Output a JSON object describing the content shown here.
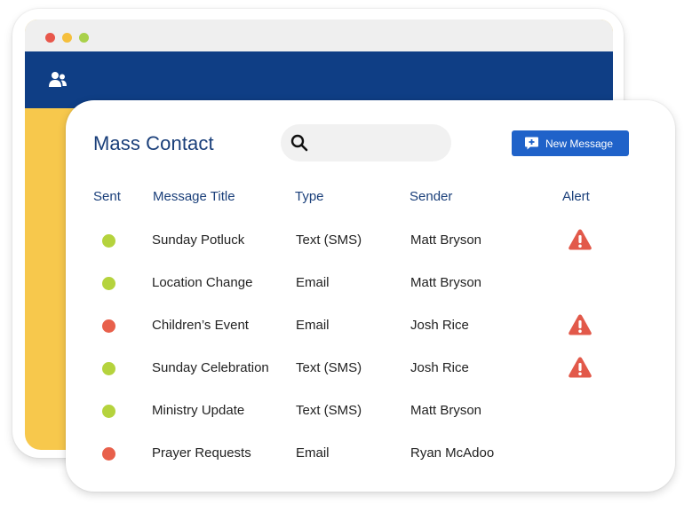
{
  "app": {
    "title": "Mass Contact"
  },
  "search": {
    "placeholder": ""
  },
  "toolbar": {
    "new_message_label": "New Message"
  },
  "colors": {
    "brand_navy": "#0f3e85",
    "accent_blue": "#1f62c9",
    "sent_ok": "#b5d33d",
    "sent_fail": "#e8604b",
    "alert": "#e2594a"
  },
  "table": {
    "headers": {
      "sent": "Sent",
      "title": "Message Title",
      "type": "Type",
      "sender": "Sender",
      "alert": "Alert"
    },
    "rows": [
      {
        "status": "sent",
        "title": "Sunday Potluck",
        "type": "Text (SMS)",
        "sender": "Matt Bryson",
        "alert": true
      },
      {
        "status": "sent",
        "title": "Location Change",
        "type": "Email",
        "sender": "Matt Bryson",
        "alert": false
      },
      {
        "status": "failed",
        "title": "Children’s Event",
        "type": "Email",
        "sender": "Josh Rice",
        "alert": true
      },
      {
        "status": "sent",
        "title": "Sunday Celebration",
        "type": "Text (SMS)",
        "sender": "Josh Rice",
        "alert": true
      },
      {
        "status": "sent",
        "title": "Ministry Update",
        "type": "Text (SMS)",
        "sender": "Matt Bryson",
        "alert": false
      },
      {
        "status": "failed",
        "title": "Prayer Requests",
        "type": "Email",
        "sender": "Ryan McAdoo",
        "alert": false
      }
    ]
  }
}
